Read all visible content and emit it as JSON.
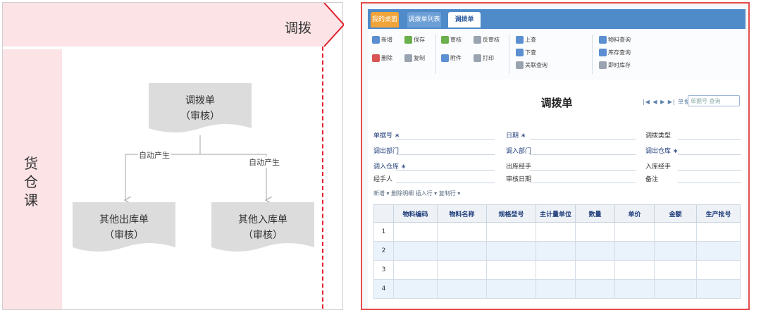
{
  "flow": {
    "header_title": "调拨",
    "department": "货\n仓\n课",
    "colors": {
      "band": "#fbe3e6",
      "doc_fill": "#dcdcdc",
      "dashed": "#e0212e",
      "arrow": "#e0212e"
    },
    "nodes": {
      "transfer": {
        "title": "调拨单",
        "status": "（审核）"
      },
      "other_out": {
        "title": "其他出库单",
        "status": "（审核）"
      },
      "other_in": {
        "title": "其他入库单",
        "status": "（审核）"
      }
    },
    "edges": {
      "to_out": "自动产生",
      "to_in": "自动产生"
    }
  },
  "app": {
    "tabs": [
      "我的桌面",
      "调拨单列表",
      "调拨单"
    ],
    "colors": {
      "frame": "#e74c4c",
      "tabbar": "#4f8ac9",
      "active_tab_text": "#2c5aa0"
    },
    "toolbar": {
      "g1": [
        "新增",
        "保存",
        "删除",
        "复制"
      ],
      "g2": [
        "审核",
        "反审核",
        "附件",
        "打印"
      ],
      "g3": [
        "上查",
        "下查",
        "关联查询"
      ],
      "g4": [
        "物料查询",
        "库存查询",
        "即时库存"
      ]
    },
    "form": {
      "title": "调拨单",
      "pager": "|◀ ◀ ▶ ▶| 单据查询",
      "search_placeholder": "单据号 查询",
      "fields": {
        "doc_no": "单据号 ∗",
        "date": "日期 ∗",
        "transfer_type": "调拨类型",
        "out_dept": "调出部门",
        "in_dept": "调入部门",
        "out_wh": "调出仓库 ∗",
        "in_wh": "调入仓库 ∗",
        "out_owner": "出库经手",
        "in_owner": "入库经手",
        "handler": "经手人",
        "auditor": "审核日期",
        "remark": "备注"
      },
      "grid_toolbar": "新增 ▾  删除明细    插入行 ▾  复制行 ▾",
      "columns": [
        "物料编码",
        "物料名称",
        "规格型号",
        "主计量单位",
        "数量",
        "单价",
        "金额",
        "生产批号"
      ],
      "rows": [
        "1",
        "2",
        "3",
        "4"
      ]
    }
  }
}
